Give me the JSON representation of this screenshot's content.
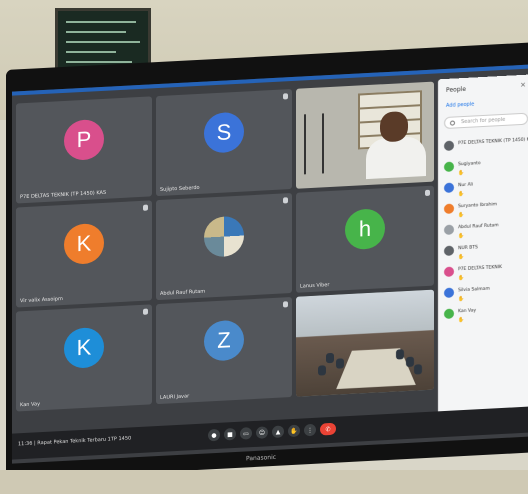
{
  "tiles": [
    {
      "letter": "P",
      "name": "P7E DELTAS TEKNIK (TP 1450) KAS",
      "color": "#d94f8c"
    },
    {
      "letter": "S",
      "name": "Sujipto Seberdo",
      "color": "#3b73d9"
    },
    {
      "letter": "",
      "name": "",
      "color": ""
    },
    {
      "letter": "K",
      "name": "Vir valix Assoipm",
      "color": "#ef7d2c"
    },
    {
      "letter": "",
      "name": "Abdul Rauf Rutam",
      "color": ""
    },
    {
      "letter": "h",
      "name": "Lanus Viber",
      "color": "#47b44a"
    },
    {
      "letter": "K",
      "name": "Kan Vay",
      "color": "#1e8ed8"
    },
    {
      "letter": "Z",
      "name": "LAURI Javar",
      "color": "#4a8acb"
    },
    {
      "letter": "",
      "name": "",
      "color": ""
    }
  ],
  "panel": {
    "title": "People",
    "close": "×",
    "add": "Add people",
    "search_placeholder": "Search for people",
    "participants": [
      {
        "name": "P7E DELTAS TEKNIK (TP 1450) KAS",
        "color": "#5f6368"
      },
      {
        "name": "Sugiyanto",
        "color": "#47b44a"
      },
      {
        "name": "Nur Ali",
        "color": "#3b73d9"
      },
      {
        "name": "Suryanto Ibrahim",
        "color": "#ef7d2c"
      },
      {
        "name": "Abdul Rauf Rutam",
        "color": "#9aa0a6"
      },
      {
        "name": "NUR BTS",
        "color": "#5f6368"
      },
      {
        "name": "P7E DELTAS TEKNIK",
        "color": "#d94f8c"
      },
      {
        "name": "Silvia Salmam",
        "color": "#3b73d9"
      },
      {
        "name": "Kan Vay",
        "color": "#47b44a"
      }
    ]
  },
  "controls": {
    "meeting_info": "11:36  |  Rapat Pekan Teknik Terbaru 1TP 1450",
    "buttons": [
      "mic-icon",
      "camera-icon",
      "captions-icon",
      "emoji-icon",
      "present-icon",
      "raise-hand-icon",
      "more-icon",
      "end-call-icon"
    ]
  },
  "brand": "Panasonic"
}
